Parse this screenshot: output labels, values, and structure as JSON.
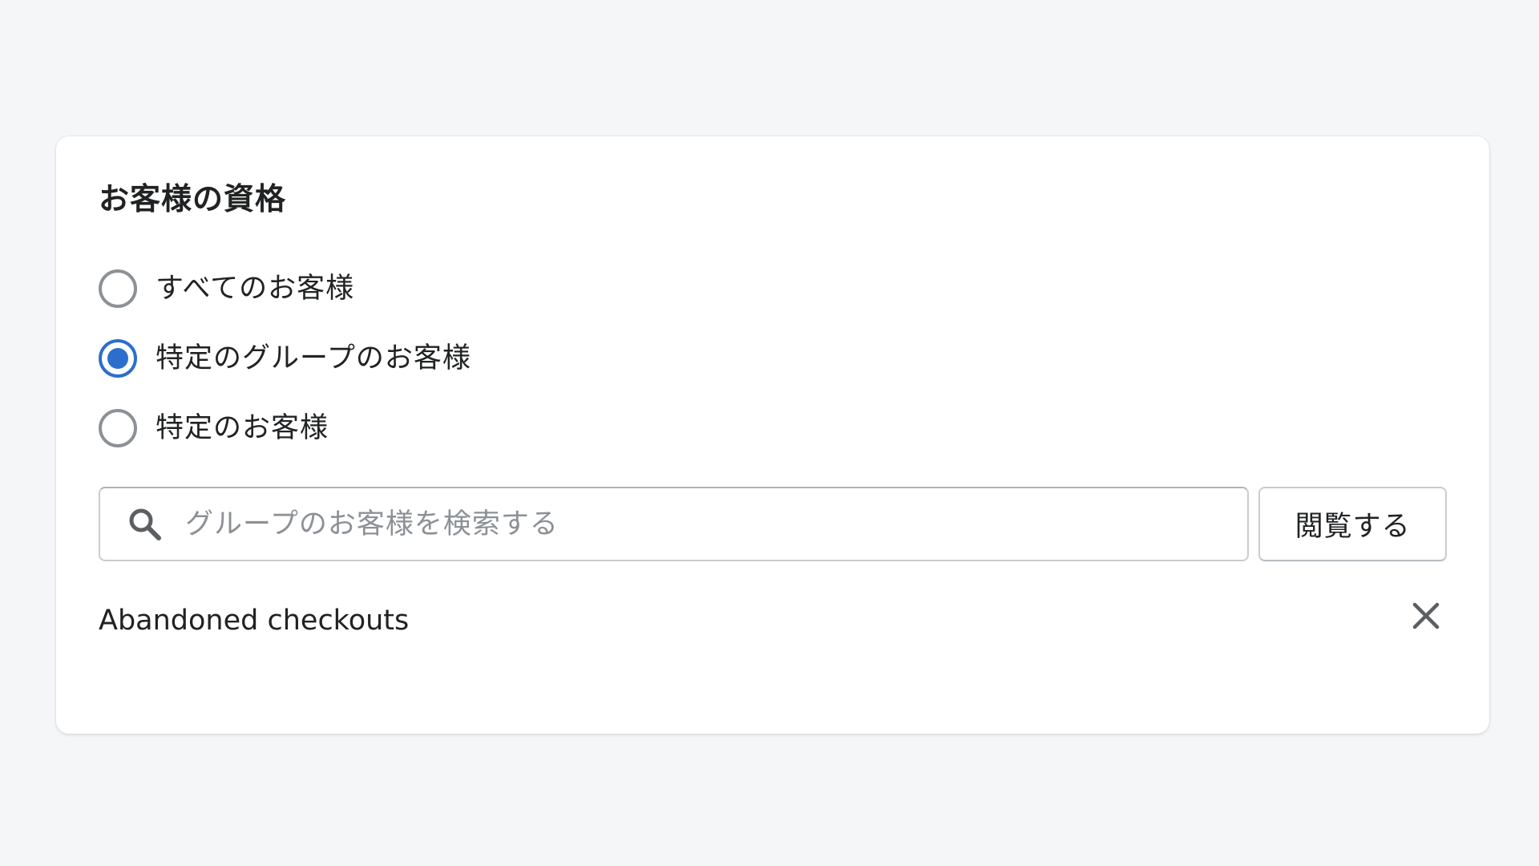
{
  "card": {
    "title": "お客様の資格"
  },
  "eligibility": {
    "options": [
      {
        "label": "すべてのお客様",
        "checked": false
      },
      {
        "label": "特定のグループのお客様",
        "checked": true
      },
      {
        "label": "特定のお客様",
        "checked": false
      }
    ]
  },
  "search": {
    "placeholder": "グループのお客様を検索する",
    "value": "",
    "icon": "search-icon"
  },
  "browse_button": {
    "label": "閲覧する"
  },
  "selected_groups": [
    {
      "label": "Abandoned checkouts",
      "remove_icon": "close-icon"
    }
  ],
  "colors": {
    "accent": "#2c6ecb",
    "background": "#f5f6f8",
    "card": "#ffffff",
    "text": "#202223",
    "placeholder": "#8c9196",
    "border": "#c9cccf"
  }
}
